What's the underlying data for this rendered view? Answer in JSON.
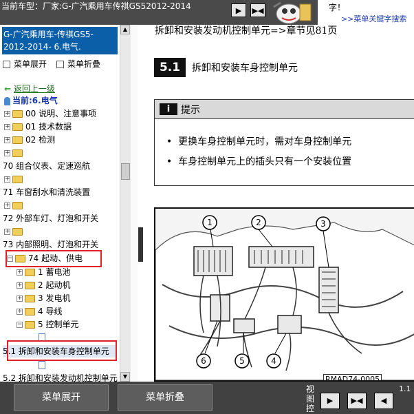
{
  "header": {
    "model": "当前车型：厂家:G-广汽乘用车传祺GS52012-2014",
    "nav_prev_symbol": "▶",
    "nav_expand_symbol": "▶◀",
    "search_fragment": "字！",
    "search_link": ">>菜单关键字搜索"
  },
  "sidebar": {
    "doc_title": "G-广汽乘用车-传祺GS5-2012-2014- 6.电气.",
    "expand_all": "菜单展开",
    "collapse_all": "菜单折叠",
    "back": "返回上一级",
    "current": "当前:6.电气",
    "items": [
      {
        "label": "00 说明、注意事项"
      },
      {
        "label": "01 技术数据"
      },
      {
        "label": "02 检测"
      },
      {
        "label": ""
      },
      {
        "label": "70 组合仪表、定速巡航"
      },
      {
        "label": ""
      },
      {
        "label": "71 车窗刮水和清洗装置"
      },
      {
        "label": ""
      },
      {
        "label": "72 外部车灯、灯泡和开关"
      },
      {
        "label": ""
      },
      {
        "label": "73 内部照明、灯泡和开关"
      },
      {
        "label": "74 起动、供电"
      },
      {
        "label": "1 蓄电池"
      },
      {
        "label": "2 起动机"
      },
      {
        "label": "3 发电机"
      },
      {
        "label": "4 导线"
      },
      {
        "label": "5 控制单元"
      },
      {
        "label": "5.1 拆卸和安装车身控制单元"
      },
      {
        "label": "5.2 拆卸和安装发动机控制单元"
      }
    ]
  },
  "content": {
    "ref_line": "拆卸和安装发动机控制单元=>章节见81页",
    "section_number": "5.1",
    "section_title": "拆卸和安装车身控制单元",
    "tip_icon": "i",
    "tip_label": "提示",
    "tips": [
      "更换车身控制单元时，需对车身控制单元",
      "车身控制单元上的插头只有一个安装位置"
    ],
    "figure_caption": "RMAD74-0005",
    "callouts": [
      "1",
      "2",
      "3",
      "4",
      "5",
      "6"
    ]
  },
  "toolbar": {
    "expand_button": "菜单展开",
    "collapse_button": "菜单折叠",
    "view_label": "视图控",
    "btn_next": "▶",
    "btn_split": "▶◀",
    "btn_prev": "◀",
    "zoom_fragment": "1.1"
  },
  "colors": {
    "title_bg": "#0b5fa8",
    "highlight": "#e0202a",
    "link": "#1a3aa8"
  }
}
